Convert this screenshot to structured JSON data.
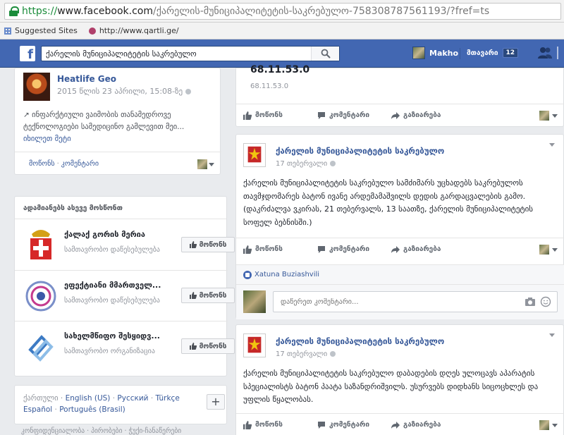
{
  "browser": {
    "url_scheme": "https://",
    "url_host": "www.facebook.com",
    "url_path": "/ქარელის-მუნიციპალიტეტის-საკრებულო-758308787561193/?fref=ts",
    "bookmarks": [
      {
        "label": "Suggested Sites",
        "icon": "grid-icon"
      },
      {
        "label": "http://www.qartli.ge/",
        "icon": "qartli-icon"
      }
    ]
  },
  "fb_header": {
    "search_value": "ქარელის მუნიციპალიტეტის საკრებულო",
    "user_name": "Makho",
    "home_label": "მთავარი",
    "home_count": "12"
  },
  "share_card": {
    "page_name": "Heatlife Geo",
    "date": "2015 წლის 23 აპრილი, 15:08-ზე",
    "text": "ინფარქტიული ვაიმობის თანამედროვე ტექნოლოგიები სამედიცინო გამლევით მეი...",
    "more": "იხილეთ მეტი",
    "like_link": "მოწონს",
    "comment_link": "კომენტარი"
  },
  "suggestions": {
    "heading": "ადამიანებს ასევე მოსწონთ",
    "like_label": "მოწონს",
    "items": [
      {
        "name": "ქალაქ გორის მერია",
        "category": "სამთავრობო დაწესებულება"
      },
      {
        "name": "ეფექტიანი მმართველ...",
        "category": "სამთავრობო დაწესებულება"
      },
      {
        "name": "სახელმწიფო შესყიდვ...",
        "category": "სამთავრობო ორგანიზაცია"
      }
    ]
  },
  "languages": {
    "current": "ქართული",
    "items": [
      "English (US)",
      "Русский",
      "Türkçe",
      "Español",
      "Português (Brasil)"
    ],
    "add_label": "+"
  },
  "footer_text": "კონფიდენციალობა · პირობები · ჭუქი-ჩანაწერები",
  "top_post": {
    "big_text": "68.11.53.0",
    "small_text": "68.11.53.0"
  },
  "actions": {
    "like": "მოწონს",
    "comment": "კომენტარი",
    "share": "გაზიარება"
  },
  "posts": [
    {
      "author": "ქარელის მუნიციპალიტეტის საკრებულო",
      "time": "17 თებერვალი",
      "text": "ქარელის მუნიციპალიტეტის საკრებულო სამძიმარს უცხადებს საკრებულოს თავმჯდომარეს ბატონ ივანე არდემამაშვილს დედის გარდაცვალების გამო. (დაკრძალვა ვკირას, 21 თებერვალს, 13 საათზე, ქარელის მუნიციპალიტეტის სოფელ ბებნისში.)",
      "liker": "Xatuna Buziashvili",
      "comment_placeholder": "დაწერეთ კომენტარი..."
    },
    {
      "author": "ქარელის მუნიციპალიტეტის საკრებულო",
      "time": "17 თებერვალი",
      "text": "ქარელის მუნიციპალიტეტის საკრებულო დაბადების დღეს ულოცავს აპარატის სპეციალისტს ბატონ პაატა საზანდრიშვილს. უსურვებს დიდხანს სიცოცხლეს და უფლის წყალობას."
    }
  ],
  "colors": {
    "fb_blue": "#4267b2",
    "link": "#365899",
    "ssl_green": "#1a8c3a"
  }
}
